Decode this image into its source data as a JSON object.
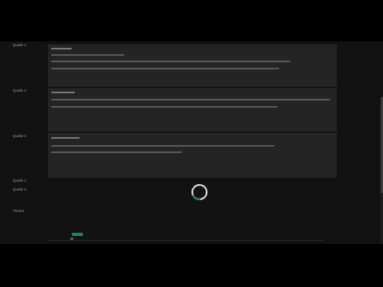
{
  "rows": [
    {
      "id": "row1",
      "label": "Quelle 1"
    },
    {
      "id": "row2",
      "label": "Quelle 2"
    },
    {
      "id": "row3",
      "label": "Quelle 3"
    },
    {
      "id": "row4",
      "label": "Quelle 4"
    },
    {
      "id": "row5",
      "label": "Quelle 5"
    },
    {
      "id": "row6",
      "label": "Thema"
    }
  ],
  "colors": {
    "background": "#121212",
    "panel": "#242424",
    "accent": "#2e7d5b",
    "spinner_track": "#d8d8d8"
  },
  "status": {
    "loading_indicator": "spinner-icon"
  }
}
